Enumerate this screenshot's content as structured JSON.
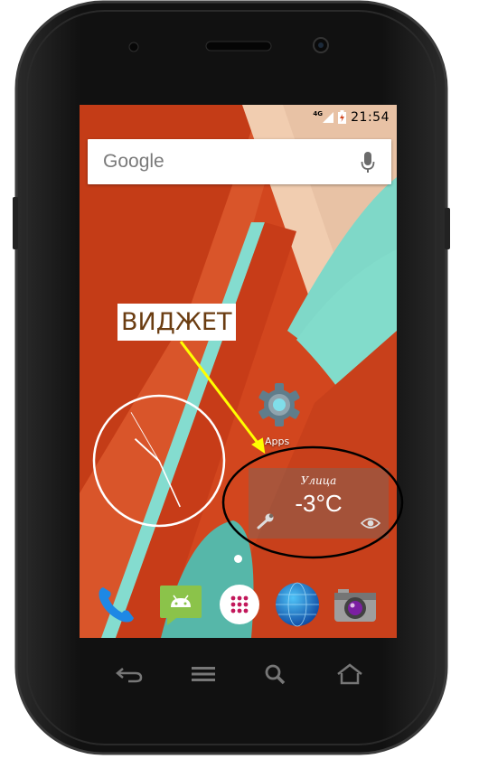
{
  "status_bar": {
    "network": "4G",
    "time": "21:54"
  },
  "search": {
    "label": "Google"
  },
  "home": {
    "apps_label": "Apps"
  },
  "clock": {
    "hour": 10,
    "minute": 25,
    "second": 55
  },
  "weather": {
    "location": "Улица",
    "temperature": "-3°C"
  },
  "annotation": {
    "label": "ВИДЖЕТ",
    "color": "#6b3d12",
    "arrow_color": "#ffff00",
    "ellipse_color": "#000000"
  },
  "dock": {
    "items": [
      {
        "name": "phone-icon"
      },
      {
        "name": "messages-icon"
      },
      {
        "name": "app-drawer-icon"
      },
      {
        "name": "browser-icon"
      },
      {
        "name": "camera-icon"
      }
    ]
  },
  "nav": {
    "items": [
      "back-icon",
      "menu-icon",
      "search-icon",
      "home-icon"
    ]
  },
  "colors": {
    "wallpaper_orange": "#d2461e",
    "wallpaper_teal": "#7fd8c8",
    "wallpaper_beige": "#f1cdb0",
    "phone_body": "#151515"
  }
}
